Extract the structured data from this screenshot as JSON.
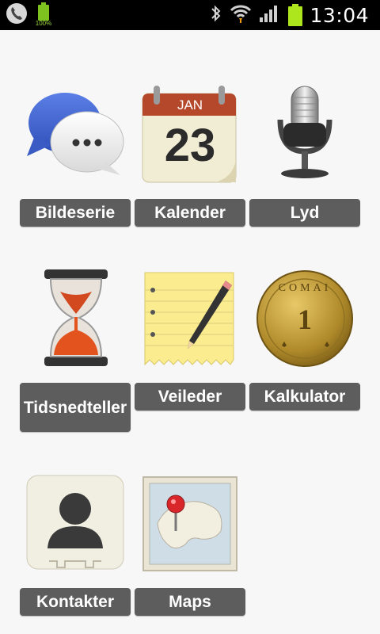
{
  "status_bar": {
    "battery_small_label": "100%",
    "time": "13:04"
  },
  "apps": [
    {
      "label": "Bildeserie"
    },
    {
      "label": "Kalender",
      "month": "JAN",
      "day": "23"
    },
    {
      "label": "Lyd"
    },
    {
      "label": "Tidsnedteller"
    },
    {
      "label": "Veileder"
    },
    {
      "label": "Kalkulator",
      "coin_text": "COMAI",
      "coin_number": "1"
    },
    {
      "label": "Kontakter"
    },
    {
      "label": "Maps"
    }
  ]
}
